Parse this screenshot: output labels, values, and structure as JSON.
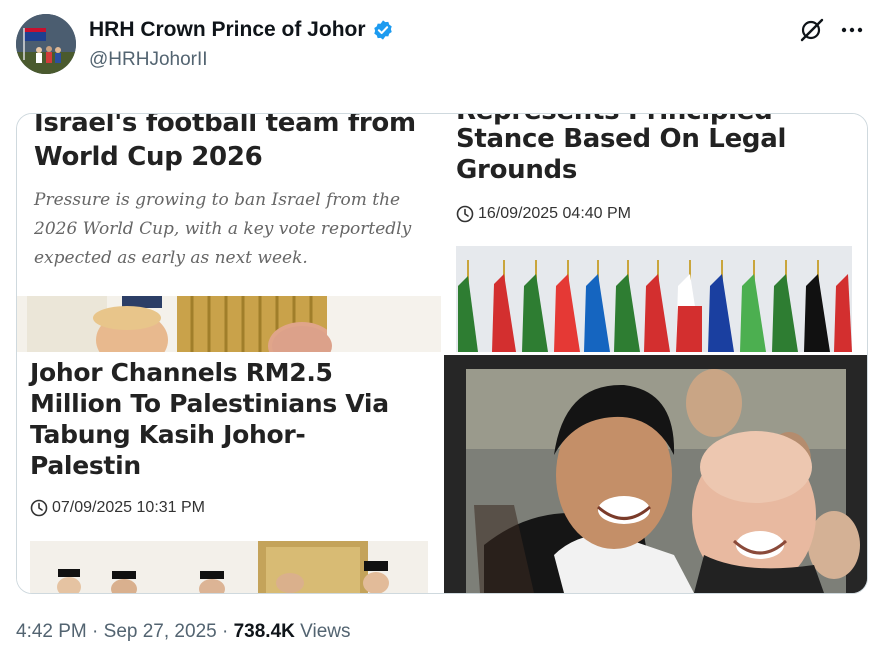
{
  "author": {
    "display_name": "HRH Crown Prince of Johor",
    "handle": "@HRHJohorII",
    "verified": true
  },
  "media": {
    "panel1": {
      "headline_line1": "Israel's football team from",
      "headline_line2": "World Cup 2026",
      "summary_line1": "Pressure is growing to ban Israel from the",
      "summary_line2": "2026 World Cup, with a key vote reportedly",
      "summary_line3": "expected as early as next week."
    },
    "panel2": {
      "headline_line1": "Represents Principled",
      "headline_line2": "Stance Based On Legal",
      "headline_line3": "Grounds",
      "timestamp": "16/09/2025 04:40 PM"
    },
    "panel3": {
      "headline_line1": "Johor Channels RM2.5",
      "headline_line2": "Million To Palestinians Via",
      "headline_line3": "Tabung Kasih Johor-",
      "headline_line4": "Palestin",
      "timestamp": "07/09/2025 10:31 PM"
    }
  },
  "footer": {
    "time": "4:42 PM",
    "separator": "·",
    "date": "Sep 27, 2025",
    "views_count": "738.4K",
    "views_label": "Views"
  },
  "colors": {
    "verified_badge": "#1d9bf0",
    "text_primary": "#0f1419",
    "text_secondary": "#536471",
    "border": "#cfd9de"
  },
  "icons": [
    "verified-badge-icon",
    "grok-icon",
    "more-icon",
    "clock-icon"
  ]
}
